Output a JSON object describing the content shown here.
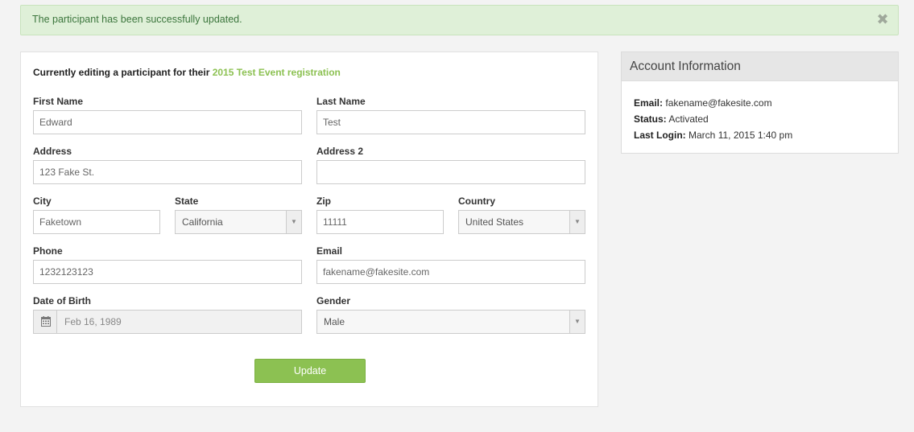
{
  "alert": {
    "message": "The participant has been successfully updated."
  },
  "heading": {
    "prefix": "Currently editing a participant for their",
    "link": "2015 Test Event registration"
  },
  "form": {
    "first_name": {
      "label": "First Name",
      "value": "Edward"
    },
    "last_name": {
      "label": "Last Name",
      "value": "Test"
    },
    "address": {
      "label": "Address",
      "value": "123 Fake St."
    },
    "address2": {
      "label": "Address 2",
      "value": ""
    },
    "city": {
      "label": "City",
      "value": "Faketown"
    },
    "state": {
      "label": "State",
      "value": "California"
    },
    "zip": {
      "label": "Zip",
      "value": "11111"
    },
    "country": {
      "label": "Country",
      "value": "United States"
    },
    "phone": {
      "label": "Phone",
      "value": "1232123123"
    },
    "email": {
      "label": "Email",
      "value": "fakename@fakesite.com"
    },
    "dob": {
      "label": "Date of Birth",
      "value": "Feb 16, 1989"
    },
    "gender": {
      "label": "Gender",
      "value": "Male"
    },
    "update_label": "Update"
  },
  "account": {
    "title": "Account Information",
    "email_label": "Email:",
    "email": "fakename@fakesite.com",
    "status_label": "Status:",
    "status": "Activated",
    "login_label": "Last Login:",
    "last_login": "March 11, 2015 1:40 pm"
  },
  "icons": {
    "close": "close-icon",
    "calendar": "calendar-icon",
    "dropdown": "chevron-down-icon"
  },
  "colors": {
    "accent": "#8cc152",
    "alert_bg": "#dff0d8"
  }
}
